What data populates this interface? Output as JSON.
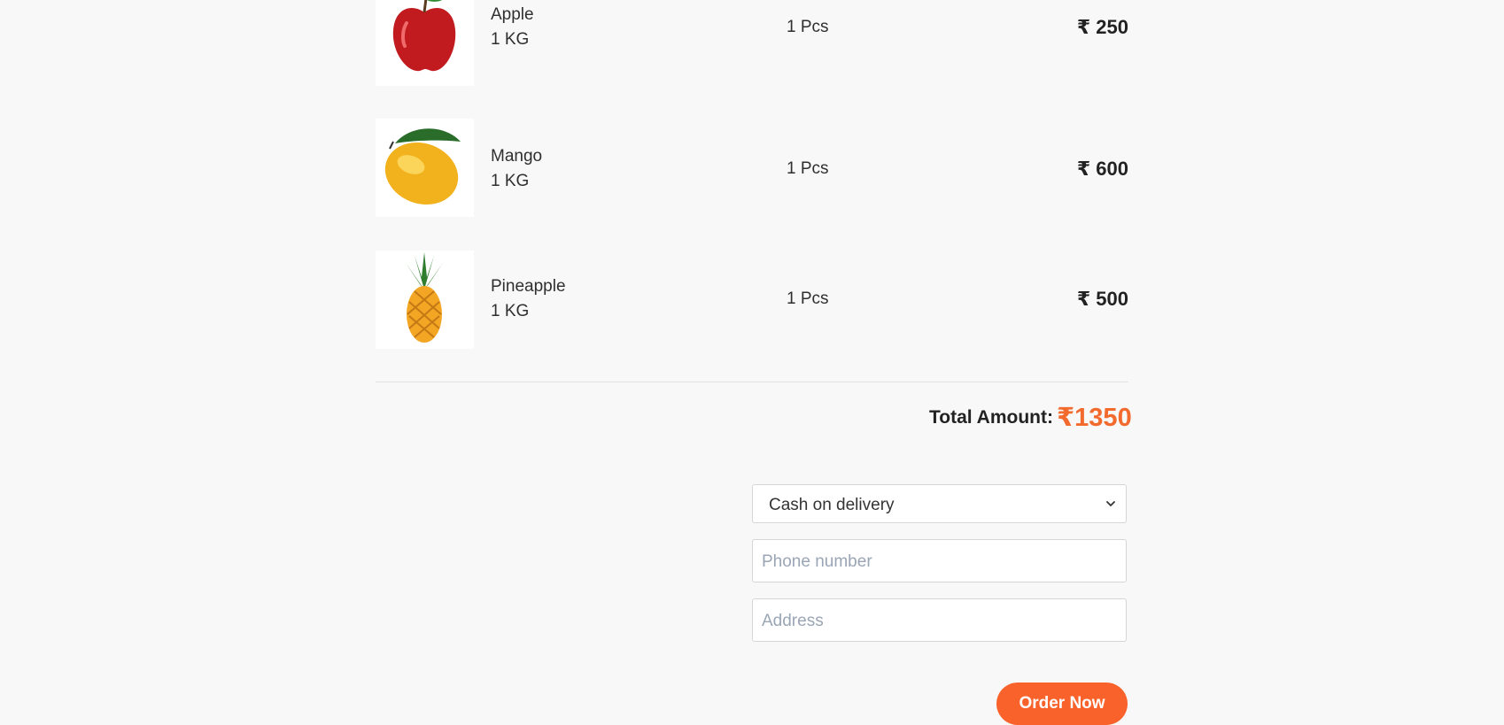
{
  "cart": {
    "items": [
      {
        "name": "Apple",
        "weight": "1 KG",
        "qty": "1 Pcs",
        "price": "₹ 250",
        "image": "apple-icon"
      },
      {
        "name": "Mango",
        "weight": "1 KG",
        "qty": "1 Pcs",
        "price": "₹ 600",
        "image": "mango-icon"
      },
      {
        "name": "Pineapple",
        "weight": "1 KG",
        "qty": "1 Pcs",
        "price": "₹ 500",
        "image": "pineapple-icon"
      }
    ],
    "total_label": "Total Amount:",
    "total_value": "₹1350"
  },
  "checkout": {
    "payment_method": "Cash on delivery",
    "phone_placeholder": "Phone number",
    "address_placeholder": "Address",
    "order_button": "Order Now",
    "accent_color": "#f9632b"
  }
}
